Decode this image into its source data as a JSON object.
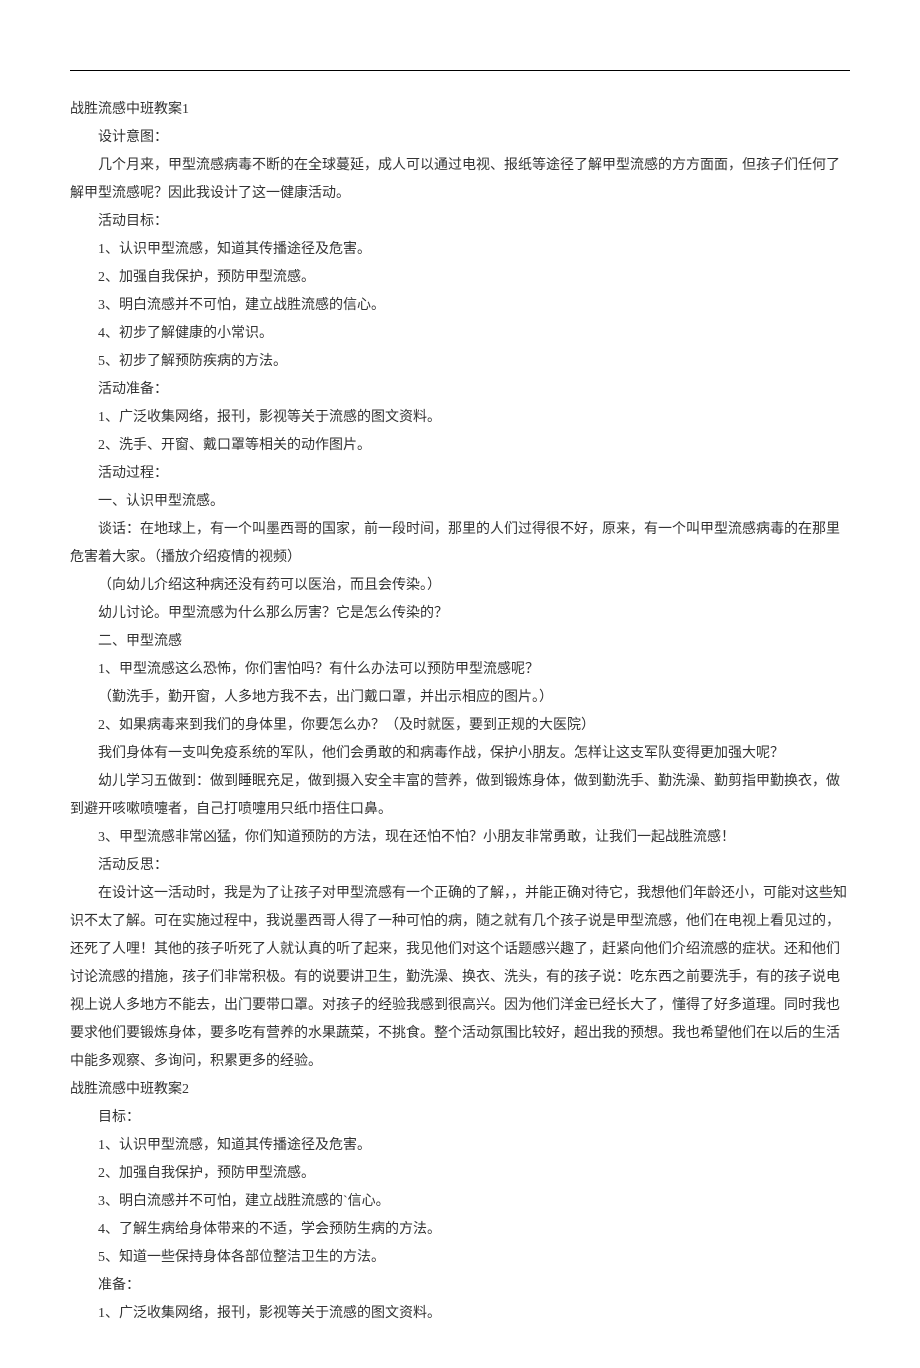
{
  "sections": [
    {
      "cls": "title-line",
      "text": "战胜流感中班教案1"
    },
    {
      "cls": "para",
      "text": "设计意图："
    },
    {
      "cls": "para",
      "text": "几个月来，甲型流感病毒不断的在全球蔓延，成人可以通过电视、报纸等途径了解甲型流感的方方面面，但孩子们任何了解甲型流感呢？因此我设计了这一健康活动。"
    },
    {
      "cls": "para",
      "text": "活动目标："
    },
    {
      "cls": "list-item",
      "text": "1、认识甲型流感，知道其传播途径及危害。"
    },
    {
      "cls": "list-item",
      "text": "2、加强自我保护，预防甲型流感。"
    },
    {
      "cls": "list-item",
      "text": "3、明白流感并不可怕，建立战胜流感的信心。"
    },
    {
      "cls": "list-item",
      "text": "4、初步了解健康的小常识。"
    },
    {
      "cls": "list-item",
      "text": "5、初步了解预防疾病的方法。"
    },
    {
      "cls": "para",
      "text": "活动准备："
    },
    {
      "cls": "list-item",
      "text": "1、广泛收集网络，报刊，影视等关于流感的图文资料。"
    },
    {
      "cls": "list-item",
      "text": "2、洗手、开窗、戴口罩等相关的动作图片。"
    },
    {
      "cls": "para",
      "text": "活动过程："
    },
    {
      "cls": "para",
      "text": "一、认识甲型流感。"
    },
    {
      "cls": "para",
      "text": "谈话：在地球上，有一个叫墨西哥的国家，前一段时间，那里的人们过得很不好，原来，有一个叫甲型流感病毒的在那里危害着大家。（播放介绍疫情的视频）"
    },
    {
      "cls": "para",
      "text": "（向幼儿介绍这种病还没有药可以医治，而且会传染。）"
    },
    {
      "cls": "para",
      "text": "幼儿讨论。甲型流感为什么那么厉害？它是怎么传染的？"
    },
    {
      "cls": "para",
      "text": "二、甲型流感"
    },
    {
      "cls": "list-item",
      "text": "1、甲型流感这么恐怖，你们害怕吗？有什么办法可以预防甲型流感呢？"
    },
    {
      "cls": "para",
      "text": "（勤洗手，勤开窗，人多地方我不去，出门戴口罩，并出示相应的图片。）"
    },
    {
      "cls": "list-item",
      "text": "2、如果病毒来到我们的身体里，你要怎么办？（及时就医，要到正规的大医院）"
    },
    {
      "cls": "para",
      "text": "我们身体有一支叫免疫系统的军队，他们会勇敢的和病毒作战，保护小朋友。怎样让这支军队变得更加强大呢？"
    },
    {
      "cls": "para",
      "text": "幼儿学习五做到：做到睡眠充足，做到摄入安全丰富的营养，做到锻炼身体，做到勤洗手、勤洗澡、勤剪指甲勤换衣，做到避开咳嗽喷嚏者，自己打喷嚏用只纸巾捂住口鼻。"
    },
    {
      "cls": "list-item",
      "text": "3、甲型流感非常凶猛，你们知道预防的方法，现在还怕不怕？小朋友非常勇敢，让我们一起战胜流感！"
    },
    {
      "cls": "para",
      "text": "活动反思："
    },
    {
      "cls": "para",
      "text": "在设计这一活动时，我是为了让孩子对甲型流感有一个正确的了解，，并能正确对待它，我想他们年龄还小，可能对这些知识不太了解。可在实施过程中，我说墨西哥人得了一种可怕的病，随之就有几个孩子说是甲型流感，他们在电视上看见过的，还死了人哩！其他的孩子听死了人就认真的听了起来，我见他们对这个话题感兴趣了，赶紧向他们介绍流感的症状。还和他们讨论流感的措施，孩子们非常积极。有的说要讲卫生，勤洗澡、换衣、洗头，有的孩子说：吃东西之前要洗手，有的孩子说电视上说人多地方不能去，出门要带口罩。对孩子的经验我感到很高兴。因为他们洋金已经长大了，懂得了好多道理。同时我也要求他们要锻炼身体，要多吃有营养的水果蔬菜，不挑食。整个活动氛围比较好，超出我的预想。我也希望他们在以后的生活中能多观察、多询问，积累更多的经验。"
    },
    {
      "cls": "title-line",
      "text": "战胜流感中班教案2"
    },
    {
      "cls": "para",
      "text": "目标："
    },
    {
      "cls": "list-item",
      "text": "1、认识甲型流感，知道其传播途径及危害。"
    },
    {
      "cls": "list-item",
      "text": "2、加强自我保护，预防甲型流感。"
    },
    {
      "cls": "list-item",
      "text": "3、明白流感并不可怕，建立战胜流感的`信心。"
    },
    {
      "cls": "list-item",
      "text": "4、了解生病给身体带来的不适，学会预防生病的方法。"
    },
    {
      "cls": "list-item",
      "text": "5、知道一些保持身体各部位整洁卫生的方法。"
    },
    {
      "cls": "para",
      "text": "准备："
    },
    {
      "cls": "list-item",
      "text": "1、广泛收集网络，报刊，影视等关于流感的图文资料。"
    }
  ]
}
